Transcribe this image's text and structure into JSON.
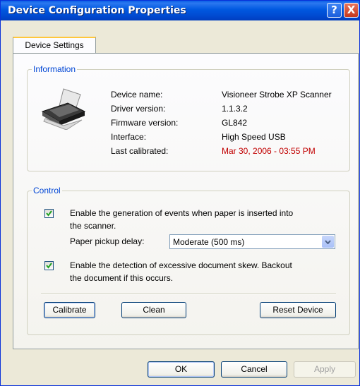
{
  "window": {
    "title": "Device Configuration Properties",
    "help_glyph": "?",
    "close_glyph": "X"
  },
  "tabs": [
    {
      "label": "Device Settings",
      "active": true
    }
  ],
  "information": {
    "legend": "Information",
    "icon": "scanner-icon",
    "rows": [
      {
        "label": "Device name:",
        "value": "Visioneer Strobe XP Scanner"
      },
      {
        "label": "Driver version:",
        "value": "1.1.3.2"
      },
      {
        "label": "Firmware version:",
        "value": "GL842"
      },
      {
        "label": "Interface:",
        "value": "High Speed USB"
      },
      {
        "label": "Last calibrated:",
        "value": "Mar 30, 2006 - 03:55 PM"
      }
    ],
    "calibrated_color": "#c10000"
  },
  "control": {
    "legend": "Control",
    "events_checkbox": {
      "checked": true,
      "line1": "Enable the generation of events when paper is inserted into",
      "line2": "the scanner."
    },
    "pickup_delay": {
      "label": "Paper pickup delay:",
      "value": "Moderate (500 ms)"
    },
    "skew_checkbox": {
      "checked": true,
      "line1": "Enable the detection of excessive document skew. Backout",
      "line2": "the document if this occurs."
    },
    "buttons": {
      "calibrate": "Calibrate",
      "clean": "Clean",
      "reset": "Reset Device"
    }
  },
  "footer": {
    "ok": "OK",
    "cancel": "Cancel",
    "apply": "Apply"
  },
  "colors": {
    "title_bar": "#0058e0",
    "legend_text": "#0046d5",
    "dialog_bg": "#ece9d8"
  }
}
